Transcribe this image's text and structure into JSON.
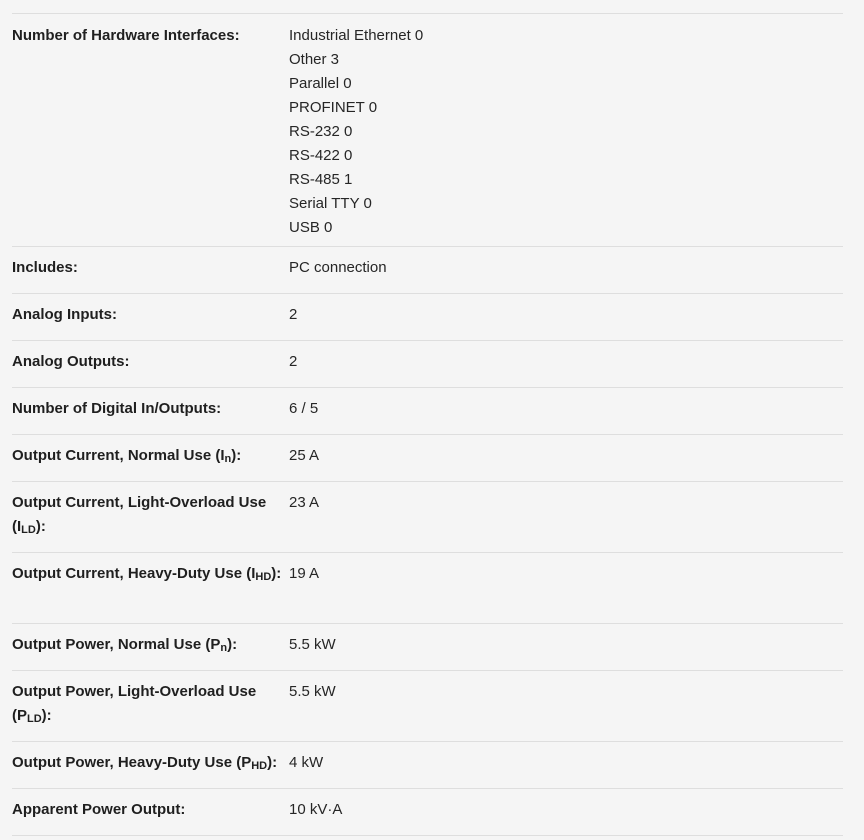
{
  "rows": [
    {
      "label": "Number of Hardware Interfaces:",
      "values": [
        "Industrial Ethernet 0",
        "Other 3",
        "Parallel 0",
        "PROFINET 0",
        "RS-232 0",
        "RS-422 0",
        "RS-485 1",
        "Serial TTY 0",
        "USB 0"
      ]
    },
    {
      "label": "Includes:",
      "value": "PC connection"
    },
    {
      "label": "Analog Inputs:",
      "value": "2"
    },
    {
      "label": "Analog Outputs:",
      "value": "2"
    },
    {
      "label": "Number of Digital In/Outputs:",
      "value": "6 / 5"
    },
    {
      "label_prefix": "Output Current, Normal Use (I",
      "label_sub": "n",
      "label_suffix": "):",
      "value": "25 A"
    },
    {
      "label_prefix": "Output Current, Light-Overload Use (I",
      "label_sub": "LD",
      "label_suffix": "):",
      "value": "23 A"
    },
    {
      "label_prefix": "Output Current, Heavy-Duty Use (I",
      "label_sub": "HD",
      "label_suffix": "):",
      "value": "19 A"
    },
    {
      "label_prefix": "Output Power, Normal Use (P",
      "label_sub": "n",
      "label_suffix": "):",
      "value": "5.5 kW"
    },
    {
      "label_prefix": "Output Power, Light-Overload Use (P",
      "label_sub": "LD",
      "label_suffix": "):",
      "value": "5.5 kW"
    },
    {
      "label_prefix": "Output Power, Heavy-Duty Use (P",
      "label_sub": "HD",
      "label_suffix": "):",
      "value": "4 kW"
    },
    {
      "label": "Apparent Power Output:",
      "value": "10 kV·A"
    }
  ]
}
